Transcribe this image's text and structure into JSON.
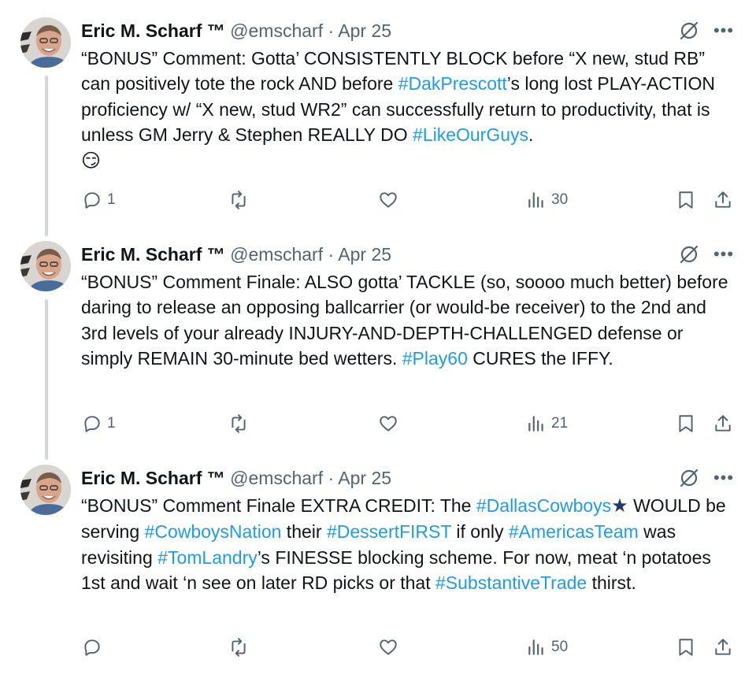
{
  "colors": {
    "link": "#1d9bf0",
    "muted": "#536471",
    "text": "#0f1419",
    "thread_line": "#cfd9de"
  },
  "tweets": [
    {
      "author": {
        "name": "Eric M. Scharf ™",
        "handle": "@emscharf",
        "avatar_icon": "avatar-photo"
      },
      "separator": "·",
      "date": "Apr 25",
      "text_segments": [
        {
          "t": "“BONUS” Comment: Gotta’ CONSISTENTLY BLOCK before “X new, stud RB” can positively tote the rock AND before "
        },
        {
          "t": "#DakPrescott",
          "tag": true
        },
        {
          "t": "’s long lost PLAY-ACTION proficiency w/ “X new, stud WR2” can successfully return to productivity, that is unless GM Jerry & Stephen REALLY DO "
        },
        {
          "t": "#LikeOurGuys",
          "tag": true
        },
        {
          "t": "."
        }
      ],
      "emoji": "😏",
      "replies": "1",
      "views": "30"
    },
    {
      "author": {
        "name": "Eric M. Scharf ™",
        "handle": "@emscharf",
        "avatar_icon": "avatar-photo"
      },
      "separator": "·",
      "date": "Apr 25",
      "text_segments": [
        {
          "t": "“BONUS” Comment Finale: ALSO gotta’ TACKLE (so, soooo much better) before daring to release an opposing ballcarrier (or would-be receiver) to the 2nd and 3rd levels of your already INJURY-AND-DEPTH-CHALLENGED defense or simply REMAIN 30-minute bed wetters. "
        },
        {
          "t": "#Play60",
          "tag": true
        },
        {
          "t": " CURES the IFFY."
        }
      ],
      "emoji": "",
      "replies": "1",
      "views": "21"
    },
    {
      "author": {
        "name": "Eric M. Scharf ™",
        "handle": "@emscharf",
        "avatar_icon": "avatar-photo"
      },
      "separator": "·",
      "date": "Apr 25",
      "text_segments": [
        {
          "t": "“BONUS” Comment Finale EXTRA CREDIT: The "
        },
        {
          "t": "#DallasCowboys",
          "tag": true
        },
        {
          "t": "★",
          "star": true
        },
        {
          "t": " WOULD be serving "
        },
        {
          "t": "#CowboysNation",
          "tag": true
        },
        {
          "t": " their "
        },
        {
          "t": "#DessertFIRST",
          "tag": true
        },
        {
          "t": " if only "
        },
        {
          "t": "#AmericasTeam",
          "tag": true
        },
        {
          "t": " was revisiting "
        },
        {
          "t": "#TomLandry",
          "tag": true
        },
        {
          "t": "’s FINESSE blocking scheme. For now, meat ‘n potatoes 1st and wait ‘n see on later RD picks or that "
        },
        {
          "t": "#SubstantiveTrade",
          "tag": true
        },
        {
          "t": " thirst."
        }
      ],
      "emoji": "",
      "replies": "",
      "views": "50"
    }
  ]
}
